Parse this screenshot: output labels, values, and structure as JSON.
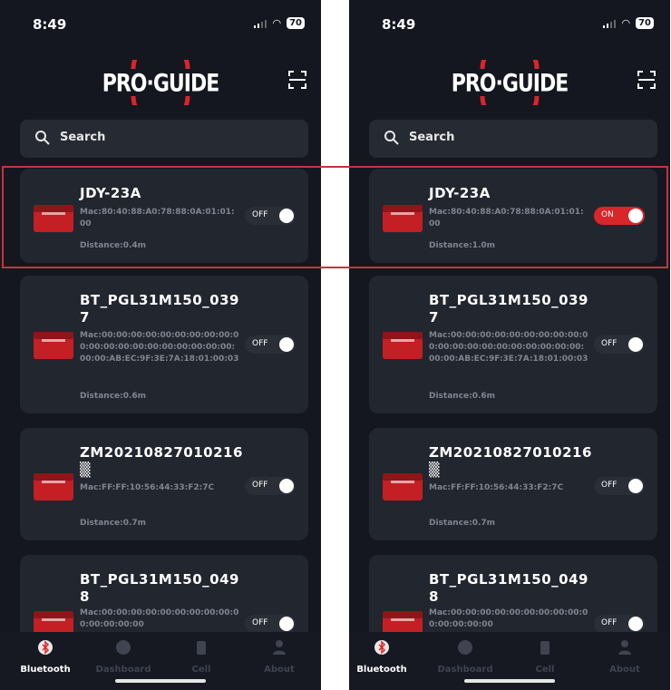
{
  "status": {
    "time": "8:49",
    "battery": "70"
  },
  "logo": {
    "text": "PRO·GUIDE"
  },
  "search": {
    "placeholder": "Search"
  },
  "panels": [
    {
      "devices": [
        {
          "name": "JDY-23A",
          "mac": "Mac:80:40:88:A0:78:88:0A:01:01:00",
          "distance": "Distance:0.4m",
          "toggle": "OFF"
        },
        {
          "name": "BT_PGL31M150_0397",
          "mac": "Mac:00:00:00:00:00:00:00:00:00:00:00:00:00:00:00:00:00:00:00:00:00:00:AB:EC:9F:3E:7A:18:01:00:03",
          "distance": "Distance:0.6m",
          "toggle": "OFF"
        },
        {
          "name": "ZM20210827010216▒",
          "mac": "Mac:FF:FF:10:56:44:33:F2:7C",
          "distance": "Distance:0.7m",
          "toggle": "OFF"
        },
        {
          "name": "BT_PGL31M150_0498",
          "mac": "Mac:00:00:00:00:00:00:00:00:00:00:00:00:00:00",
          "distance": "",
          "toggle": "OFF"
        }
      ]
    },
    {
      "devices": [
        {
          "name": "JDY-23A",
          "mac": "Mac:80:40:88:A0:78:88:0A:01:01:00",
          "distance": "Distance:1.0m",
          "toggle": "ON"
        },
        {
          "name": "BT_PGL31M150_0397",
          "mac": "Mac:00:00:00:00:00:00:00:00:00:00:00:00:00:00:00:00:00:00:00:00:00:00:AB:EC:9F:3E:7A:18:01:00:03",
          "distance": "Distance:0.6m",
          "toggle": "OFF"
        },
        {
          "name": "ZM20210827010216▒",
          "mac": "Mac:FF:FF:10:56:44:33:F2:7C",
          "distance": "Distance:0.7m",
          "toggle": "OFF"
        },
        {
          "name": "BT_PGL31M150_0498",
          "mac": "Mac:00:00:00:00:00:00:00:00:00:00:00:00:00:00",
          "distance": "",
          "toggle": "OFF"
        }
      ]
    }
  ],
  "tabs": [
    {
      "label": "Bluetooth",
      "icon": "bluetooth-icon"
    },
    {
      "label": "Dashboard",
      "icon": "dashboard-icon"
    },
    {
      "label": "Cell",
      "icon": "cell-icon"
    },
    {
      "label": "About",
      "icon": "user-icon"
    }
  ],
  "colors": {
    "background": "#141720",
    "card": "#22262f",
    "accent": "#d8262b",
    "highlight": "#c9323c"
  }
}
